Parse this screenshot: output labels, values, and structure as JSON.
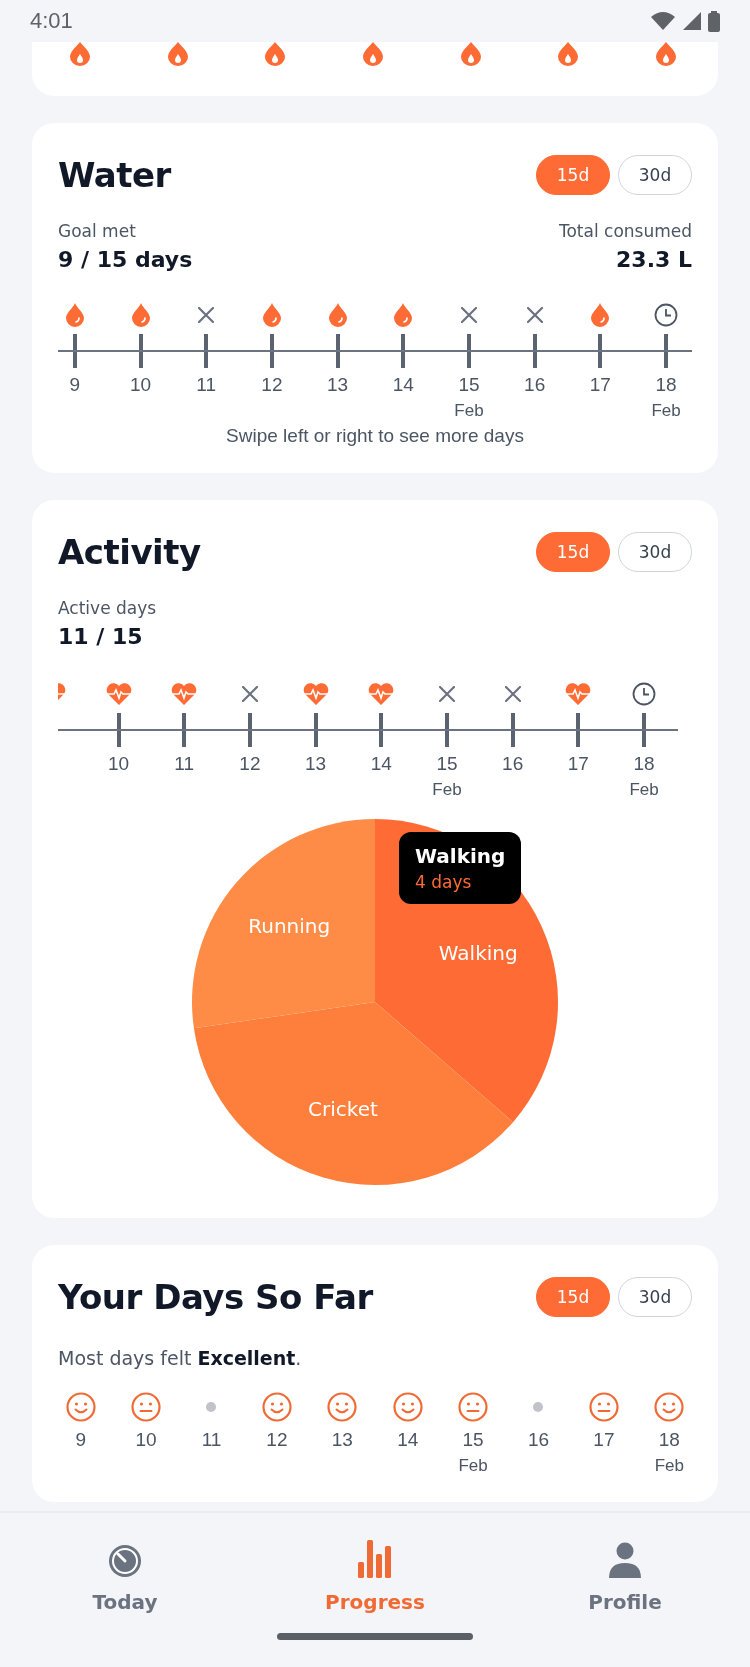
{
  "status_bar": {
    "time": "4:01"
  },
  "top_card": {
    "icons": [
      {
        "kind": "flame"
      },
      {
        "kind": "flame"
      },
      {
        "kind": "flame"
      },
      {
        "kind": "flame"
      },
      {
        "kind": "flame"
      },
      {
        "kind": "flame"
      },
      {
        "kind": "flame"
      }
    ]
  },
  "water": {
    "title": "Water",
    "ranges": [
      {
        "label": "15d",
        "selected": true
      },
      {
        "label": "30d",
        "selected": false
      }
    ],
    "left_stat": {
      "label": "Goal met",
      "value": "9 / 15 days"
    },
    "right_stat": {
      "label": "Total consumed",
      "value": "23.3 L"
    },
    "days": [
      {
        "kind": "drop",
        "day": "9"
      },
      {
        "kind": "drop",
        "day": "10"
      },
      {
        "kind": "miss",
        "day": "11"
      },
      {
        "kind": "drop",
        "day": "12"
      },
      {
        "kind": "drop",
        "day": "13"
      },
      {
        "kind": "drop",
        "day": "14"
      },
      {
        "kind": "miss",
        "day": "15",
        "month": "Feb"
      },
      {
        "kind": "miss",
        "day": "16"
      },
      {
        "kind": "drop",
        "day": "17"
      },
      {
        "kind": "clock",
        "day": "18",
        "month": "Feb"
      }
    ],
    "hint": "Swipe left or right to see more days"
  },
  "activity": {
    "title": "Activity",
    "ranges": [
      {
        "label": "15d",
        "selected": true
      },
      {
        "label": "30d",
        "selected": false
      }
    ],
    "stat": {
      "label": "Active days",
      "value": "11 / 15"
    },
    "days": [
      {
        "kind": "heart"
      },
      {
        "kind": "heart",
        "day": "10"
      },
      {
        "kind": "heart",
        "day": "11"
      },
      {
        "kind": "miss",
        "day": "12"
      },
      {
        "kind": "heart",
        "day": "13"
      },
      {
        "kind": "heart",
        "day": "14"
      },
      {
        "kind": "miss",
        "day": "15",
        "month": "Feb"
      },
      {
        "kind": "miss",
        "day": "16"
      },
      {
        "kind": "heart",
        "day": "17"
      },
      {
        "kind": "clock",
        "day": "18",
        "month": "Feb"
      }
    ],
    "chart_data": {
      "type": "pie",
      "categories": [
        "Walking",
        "Cricket",
        "Running"
      ],
      "values": [
        36.4,
        36.3,
        27.3
      ],
      "colors": [
        "#fe6b34",
        "#fe7e3c",
        "#fe8c47"
      ]
    },
    "tooltip": {
      "title": "Walking",
      "value": "4 days"
    }
  },
  "mood": {
    "title": "Your Days So Far",
    "ranges": [
      {
        "label": "15d",
        "selected": true
      },
      {
        "label": "30d",
        "selected": false
      }
    ],
    "summary": "Most days felt **Excellent**.",
    "days": [
      {
        "kind": "happy",
        "day": "9"
      },
      {
        "kind": "neutral",
        "day": "10"
      },
      {
        "kind": "none",
        "day": "11"
      },
      {
        "kind": "happy",
        "day": "12"
      },
      {
        "kind": "happy",
        "day": "13"
      },
      {
        "kind": "happy",
        "day": "14"
      },
      {
        "kind": "neutral",
        "day": "15",
        "month": "Feb"
      },
      {
        "kind": "none",
        "day": "16"
      },
      {
        "kind": "neutral",
        "day": "17"
      },
      {
        "kind": "happy",
        "day": "18",
        "month": "Feb"
      }
    ]
  },
  "nav": [
    {
      "kind": "timer",
      "label": "Today",
      "selected": false
    },
    {
      "kind": "bars",
      "label": "Progress",
      "selected": true
    },
    {
      "kind": "person",
      "label": "Profile",
      "selected": false
    }
  ]
}
